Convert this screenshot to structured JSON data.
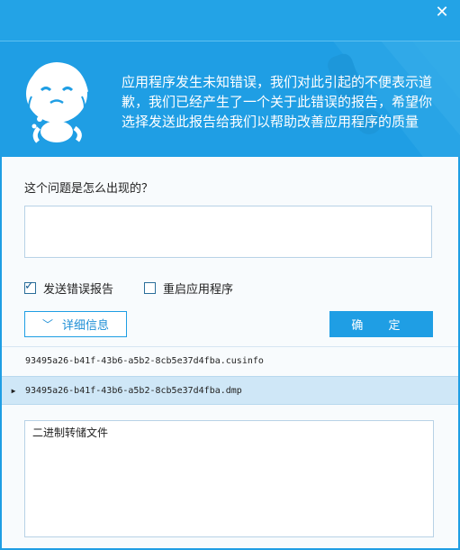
{
  "window": {
    "close_glyph": "✕"
  },
  "header": {
    "message": "应用程序发生未知错误，我们对此引起的不便表示道歉，我们已经产生了一个关于此错误的报告，希望你选择发送此报告给我们以帮助改善应用程序的质量"
  },
  "question": {
    "label": "这个问题是怎么出现的？",
    "value": ""
  },
  "options": {
    "send_report": {
      "label": "发送错误报告",
      "checked": true
    },
    "restart_app": {
      "label": "重启应用程序",
      "checked": false
    }
  },
  "buttons": {
    "details": "详细信息",
    "ok": "确 定"
  },
  "files": [
    {
      "name": "93495a26-b41f-43b6-a5b2-8cb5e37d4fba.cusinfo",
      "selected": false
    },
    {
      "name": "93495a26-b41f-43b6-a5b2-8cb5e37d4fba.dmp",
      "selected": true
    }
  ],
  "file_preview": {
    "content": "二进制转储文件"
  },
  "colors": {
    "primary": "#1f9ee4",
    "selected_row": "#cfe7f7"
  }
}
